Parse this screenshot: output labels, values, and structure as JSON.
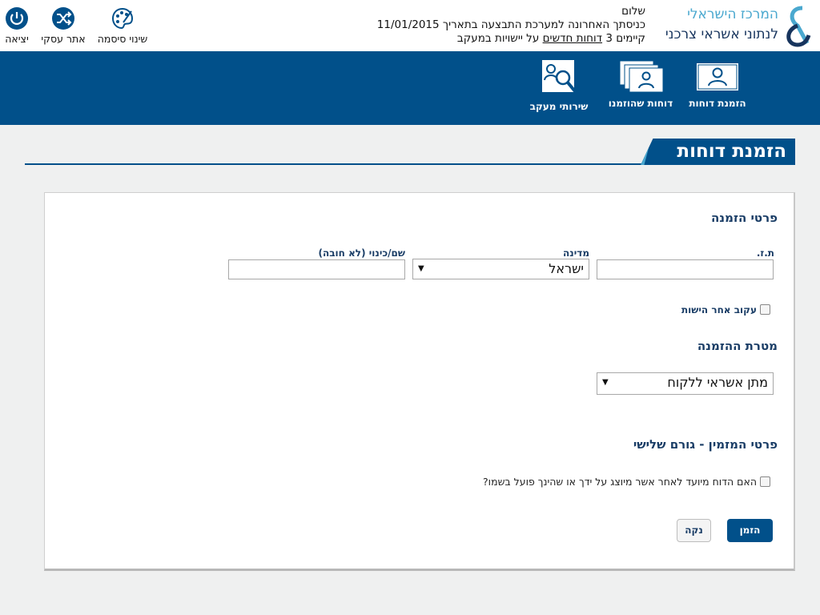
{
  "header": {
    "logo": {
      "line1": "המרכז הישראלי",
      "line2": "לנתוני אשראי צרכני"
    },
    "welcome": {
      "hello": "שלום",
      "last_login": "כניסתך האחרונה למערכת התבצעה בתאריך 11/01/2015",
      "reports_prefix": "קיימים 3",
      "reports_link": "דוחות חדשים",
      "reports_suffix": "על יישויות במעקב"
    },
    "utils": {
      "change_password": "שינוי סיסמה",
      "business_site": "אתר עסקי",
      "logout": "יציאה"
    }
  },
  "nav": {
    "order_reports": "הזמנת דוחות",
    "ordered_reports": "דוחות שהוזמנו",
    "tracking": "שירותי מעקב"
  },
  "page": {
    "title": "הזמנת דוחות"
  },
  "form": {
    "section_order": "פרטי הזמנה",
    "id_label": "ת.ז.",
    "id_value": "",
    "country_label": "מדינה",
    "country_value": "ישראל",
    "name_label": "שם/כינוי (לא חובה)",
    "name_value": "",
    "track_label": "עקוב אחר הישות",
    "purpose_title": "מטרת ההזמנה",
    "purpose_value": "מתן אשראי ללקוח",
    "section_third": "פרטי המזמין - גורם שלישי",
    "third_party_label": "האם הדוח מיועד לאחר אשר מיוצג על ידך או שהינך פועל בשמו?",
    "order_btn": "הזמן",
    "clear_btn": "נקה"
  },
  "colors": {
    "brand_blue": "#01508a",
    "accent_light": "#4aa8cf",
    "label_navy": "#1a3d66"
  }
}
